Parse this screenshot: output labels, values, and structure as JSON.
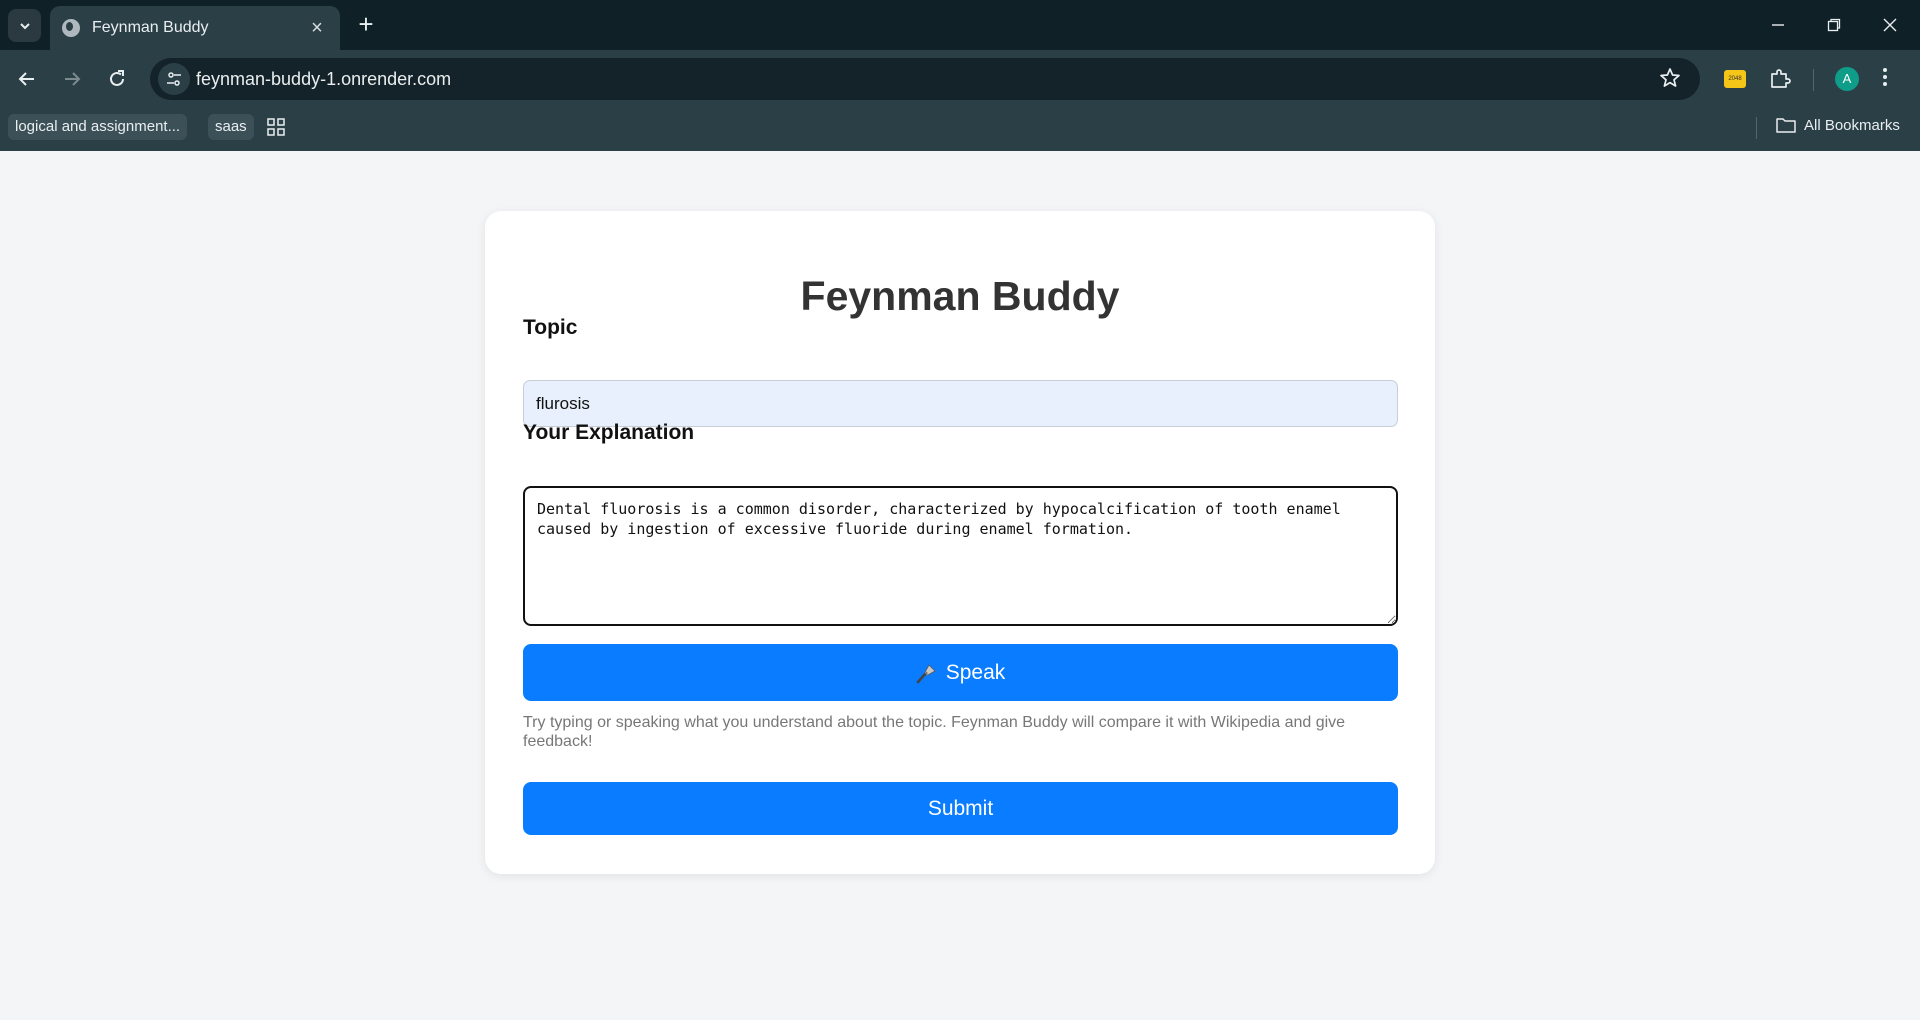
{
  "browser": {
    "tab_title": "Feynman Buddy",
    "url": "feynman-buddy-1.onrender.com",
    "extension_badge": "2048",
    "profile_initial": "A",
    "bookmarks": [
      "logical and assignment...",
      "saas"
    ],
    "all_bookmarks_label": "All Bookmarks"
  },
  "app": {
    "title": "Feynman Buddy",
    "topic_label": "Topic",
    "topic_value": "flurosis",
    "explanation_label": "Your Explanation",
    "explanation_value": "Dental fluorosis is a common disorder, characterized by hypocalcification of tooth enamel caused by ingestion of excessive fluoride during enamel formation.",
    "speak_label": "Speak",
    "speak_icon": "microphone-icon",
    "hint": "Try typing or speaking what you understand about the topic. Feynman Buddy will compare it with Wikipedia and give feedback!",
    "submit_label": "Submit",
    "accent_color": "#0a7cff"
  }
}
